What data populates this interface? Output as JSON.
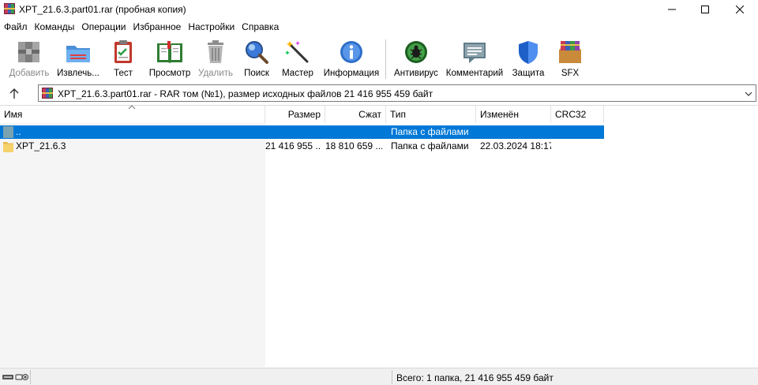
{
  "window": {
    "title": "XPT_21.6.3.part01.rar (пробная копия)"
  },
  "menu": [
    {
      "label": "Файл"
    },
    {
      "label": "Команды"
    },
    {
      "label": "Операции"
    },
    {
      "label": "Избранное"
    },
    {
      "label": "Настройки"
    },
    {
      "label": "Справка"
    }
  ],
  "toolbar": {
    "add": "Добавить",
    "extract": "Извлечь...",
    "test": "Тест",
    "view": "Просмотр",
    "delete": "Удалить",
    "find": "Поиск",
    "wizard": "Мастер",
    "info": "Информация",
    "antivirus": "Антивирус",
    "comment": "Комментарий",
    "protect": "Защита",
    "sfx": "SFX"
  },
  "address": {
    "text": "XPT_21.6.3.part01.rar - RAR том (№1), размер исходных файлов 21 416 955 459 байт"
  },
  "columns": {
    "name": "Имя",
    "size": "Размер",
    "packed": "Сжат",
    "type": "Тип",
    "modified": "Изменён",
    "crc": "CRC32"
  },
  "rows": [
    {
      "name": "..",
      "size": "",
      "packed": "",
      "type": "Папка с файлами",
      "modified": "",
      "crc": ""
    },
    {
      "name": "XPT_21.6.3",
      "size": "21 416 955 ...",
      "packed": "18 810 659 ...",
      "type": "Папка с файлами",
      "modified": "22.03.2024 18:17",
      "crc": ""
    }
  ],
  "status": {
    "summary": "Всего: 1 папка, 21 416 955 459 байт"
  },
  "colors": {
    "selection": "#0078d7",
    "folder": "#f5d26b"
  }
}
